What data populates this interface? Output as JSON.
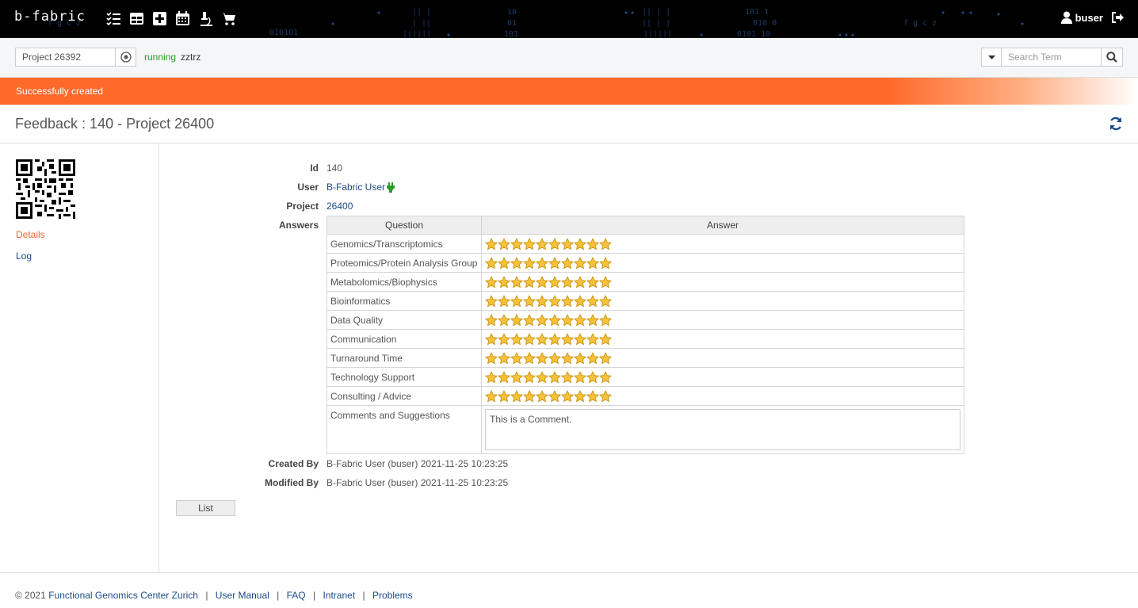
{
  "header": {
    "brand": "b-fabric",
    "nav_icons": [
      "tasks-icon",
      "table-icon",
      "plus-square-icon",
      "calendar-icon",
      "microscope-icon",
      "cart-icon"
    ],
    "username": "buser"
  },
  "toolbar": {
    "project_value": "Project 26392",
    "status": "running",
    "status_user": "zztrz",
    "search_placeholder": "Search Term"
  },
  "alert": {
    "message": "Successfully created"
  },
  "page": {
    "title": "Feedback : 140 - Project 26400"
  },
  "sidebar": {
    "details_label": "Details",
    "log_label": "Log"
  },
  "fields": {
    "id_label": "Id",
    "id_value": "140",
    "user_label": "User",
    "user_value": "B-Fabric User",
    "project_label": "Project",
    "project_value": "26400",
    "answers_label": "Answers",
    "created_label": "Created By",
    "created_value": "B-Fabric User (buser) 2021-11-25 10:23:25",
    "modified_label": "Modified By",
    "modified_value": "B-Fabric User (buser) 2021-11-25 10:23:25"
  },
  "answers": {
    "col_question": "Question",
    "col_answer": "Answer",
    "rows": [
      {
        "question": "Genomics/Transcriptomics",
        "stars": 10
      },
      {
        "question": "Proteomics/Protein Analysis Group",
        "stars": 10
      },
      {
        "question": "Metabolomics/Biophysics",
        "stars": 10
      },
      {
        "question": "Bioinformatics",
        "stars": 10
      },
      {
        "question": "Data Quality",
        "stars": 10
      },
      {
        "question": "Communication",
        "stars": 10
      },
      {
        "question": "Turnaround Time",
        "stars": 10
      },
      {
        "question": "Technology Support",
        "stars": 10
      },
      {
        "question": "Consulting / Advice",
        "stars": 10
      }
    ],
    "comments_label": "Comments and Suggestions",
    "comment": "This is a Comment."
  },
  "buttons": {
    "list_label": "List"
  },
  "footer": {
    "copyright": "© 2021",
    "org": "Functional Genomics Center Zurich",
    "links": [
      "User Manual",
      "FAQ",
      "Intranet",
      "Problems"
    ]
  },
  "colors": {
    "accent": "#ff6a2a",
    "link": "#1a4a8a",
    "running": "#2a9a2a",
    "star": "#f7c23a"
  }
}
